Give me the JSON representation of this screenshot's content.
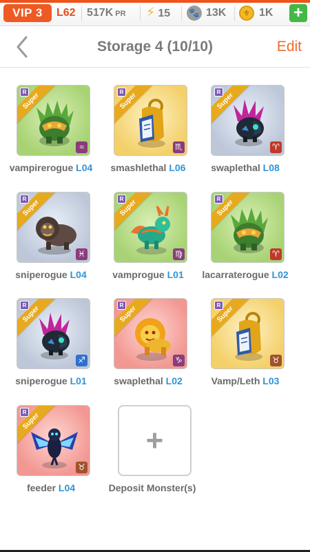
{
  "status": {
    "vip": "VIP 3",
    "level": "L62",
    "power_value": "517K",
    "power_unit": "PR",
    "energy": "15",
    "food": "13K",
    "coins": "1K",
    "add_label": "+"
  },
  "header": {
    "title": "Storage 4 (10/10)",
    "edit": "Edit"
  },
  "monsters": [
    {
      "name": "vampirerogue",
      "level": "L04",
      "rarity": "R",
      "tier": "Super",
      "background": "green",
      "sign": "≈",
      "sign_color": "#8a3c7c",
      "icon": "green-dragon-rogue-icon"
    },
    {
      "name": "smashlethal",
      "level": "L06",
      "rarity": "R",
      "tier": "Super",
      "background": "gold",
      "sign": "♏",
      "sign_color": "#8a3c7c",
      "icon": "golden-shield-icon"
    },
    {
      "name": "swaplethal",
      "level": "L08",
      "rarity": "R",
      "tier": "Super",
      "background": "gray",
      "sign": "♈",
      "sign_color": "#c0392b",
      "icon": "spiked-beast-icon"
    },
    {
      "name": "sniperogue",
      "level": "L04",
      "rarity": "R",
      "tier": "Super",
      "background": "gray",
      "sign": "♓",
      "sign_color": "#8a3c7c",
      "icon": "brown-lion-icon"
    },
    {
      "name": "vamprogue",
      "level": "L01",
      "rarity": "R",
      "tier": "Super",
      "background": "green",
      "sign": "♍",
      "sign_color": "#8a3c7c",
      "icon": "jade-dragon-icon"
    },
    {
      "name": "lacarraterogue",
      "level": "L02",
      "rarity": "R",
      "tier": "Super",
      "background": "green",
      "sign": "♈",
      "sign_color": "#c0392b",
      "icon": "green-dragon-rogue-icon"
    },
    {
      "name": "sniperogue",
      "level": "L01",
      "rarity": "R",
      "tier": "Super",
      "background": "gray",
      "sign": "♐",
      "sign_color": "#2f6fd0",
      "icon": "spiked-beast-icon"
    },
    {
      "name": "swaplethal",
      "level": "L02",
      "rarity": "R",
      "tier": "Super",
      "background": "red",
      "sign": "♑",
      "sign_color": "#8a3c7c",
      "icon": "fire-lion-icon"
    },
    {
      "name": "Vamp/Leth",
      "level": "L03",
      "rarity": "R",
      "tier": "Super",
      "background": "gold",
      "sign": "♉",
      "sign_color": "#a0522d",
      "icon": "golden-shield-icon"
    },
    {
      "name": "feeder",
      "level": "L04",
      "rarity": "R",
      "tier": "Super",
      "background": "red",
      "sign": "♉",
      "sign_color": "#a0522d",
      "icon": "blue-bird-icon"
    }
  ],
  "deposit": {
    "label": "Deposit Monster(s)",
    "plus": "+"
  }
}
